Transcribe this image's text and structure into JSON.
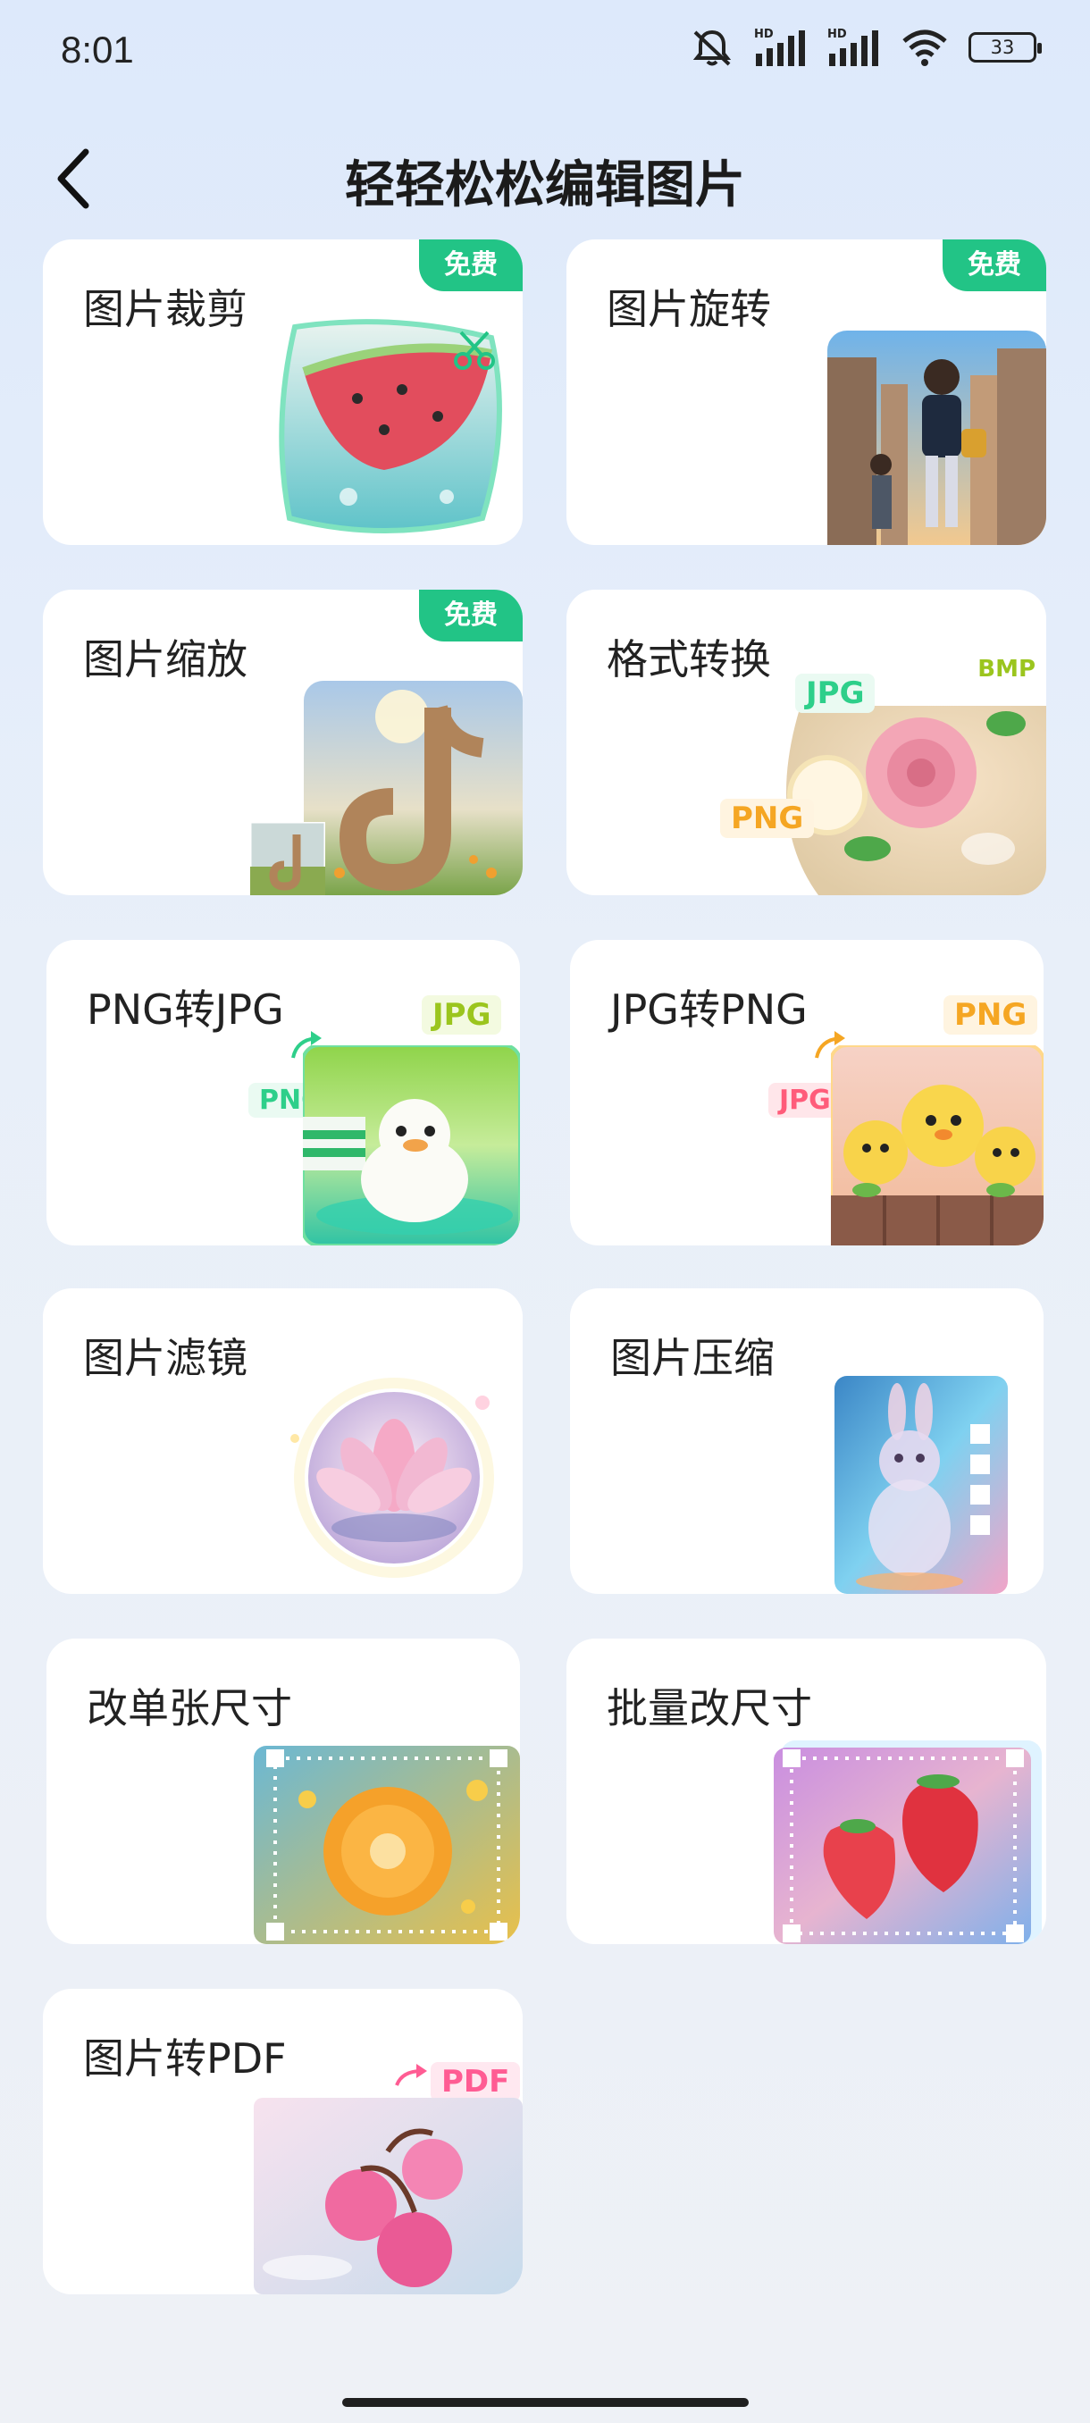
{
  "status": {
    "time": "8:01",
    "battery": "33"
  },
  "header": {
    "title": "轻轻松松编辑图片"
  },
  "tools": [
    {
      "title": "图片裁剪",
      "badge": "免费"
    },
    {
      "title": "图片旋转",
      "badge": "免费"
    },
    {
      "title": "图片缩放",
      "badge": "免费"
    },
    {
      "title": "格式转换",
      "formats": [
        "JPG",
        "BMP",
        "PNG"
      ]
    },
    {
      "title": "PNG转JPG",
      "from": "PNG",
      "to": "JPG"
    },
    {
      "title": "JPG转PNG",
      "from": "JPG",
      "to": "PNG"
    },
    {
      "title": "图片滤镜"
    },
    {
      "title": "图片压缩"
    },
    {
      "title": "改单张尺寸"
    },
    {
      "title": "批量改尺寸"
    },
    {
      "title": "图片转PDF",
      "to": "PDF"
    }
  ],
  "colors": {
    "badge": "#22c486",
    "accent_green": "#2ecf8a",
    "accent_orange": "#f5a623",
    "accent_pink": "#ff5c93"
  }
}
